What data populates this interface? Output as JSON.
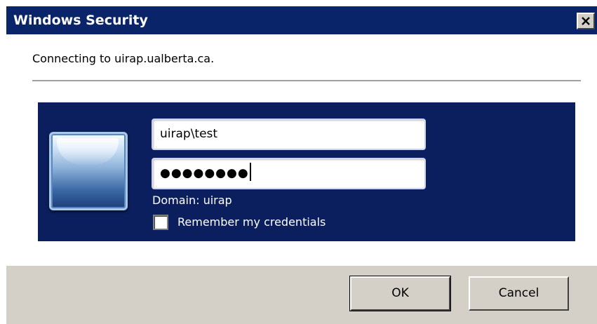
{
  "window": {
    "title": "Windows Security"
  },
  "message": {
    "connecting_text": "Connecting to uirap.ualberta.ca."
  },
  "credentials": {
    "username_value": "uirap\\test",
    "password_masked": "●●●●●●●●",
    "domain_text": "Domain: uirap",
    "remember_label": "Remember my credentials",
    "remember_checked": false
  },
  "buttons": {
    "ok_label": "OK",
    "cancel_label": "Cancel"
  },
  "icons": {
    "close": "close-icon",
    "user_tile": "user-tile-icon"
  },
  "colors": {
    "titlebar": "#0a246a",
    "credential_panel": "#0b1f5e",
    "footer": "#d4d0c8"
  }
}
